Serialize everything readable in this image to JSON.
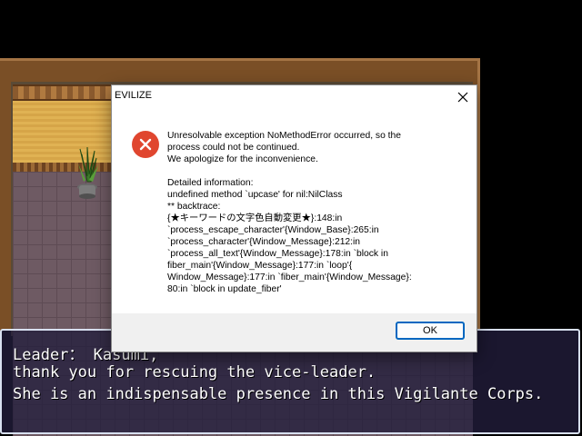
{
  "game": {
    "message_lines": [
      "Leader： Kasumi,",
      "thank you for rescuing the vice-leader.",
      "She is an indispensable presence in this Vigilante Corps."
    ]
  },
  "dialog": {
    "title": "EVILIZE",
    "icon": "error-icon",
    "close_icon": "close-icon",
    "message_lines": [
      "Unresolvable exception NoMethodError occurred, so the",
      "process could not be continued.",
      "We apologize for the inconvenience."
    ],
    "detail_lines": [
      "Detailed information:",
      "undefined method `upcase' for nil:NilClass",
      "** backtrace:",
      "{★キーワードの文字色自動変更★}:148:in",
      "`process_escape_character'{Window_Base}:265:in",
      "`process_character'{Window_Message}:212:in",
      "`process_all_text'{Window_Message}:178:in `block in",
      "fiber_main'{Window_Message}:177:in `loop'{",
      "Window_Message}:177:in `fiber_main'{Window_Message}:",
      "80:in `block in update_fiber'"
    ],
    "ok_label": "OK",
    "accent_color": "#0067c0",
    "error_color": "#e0462f"
  }
}
